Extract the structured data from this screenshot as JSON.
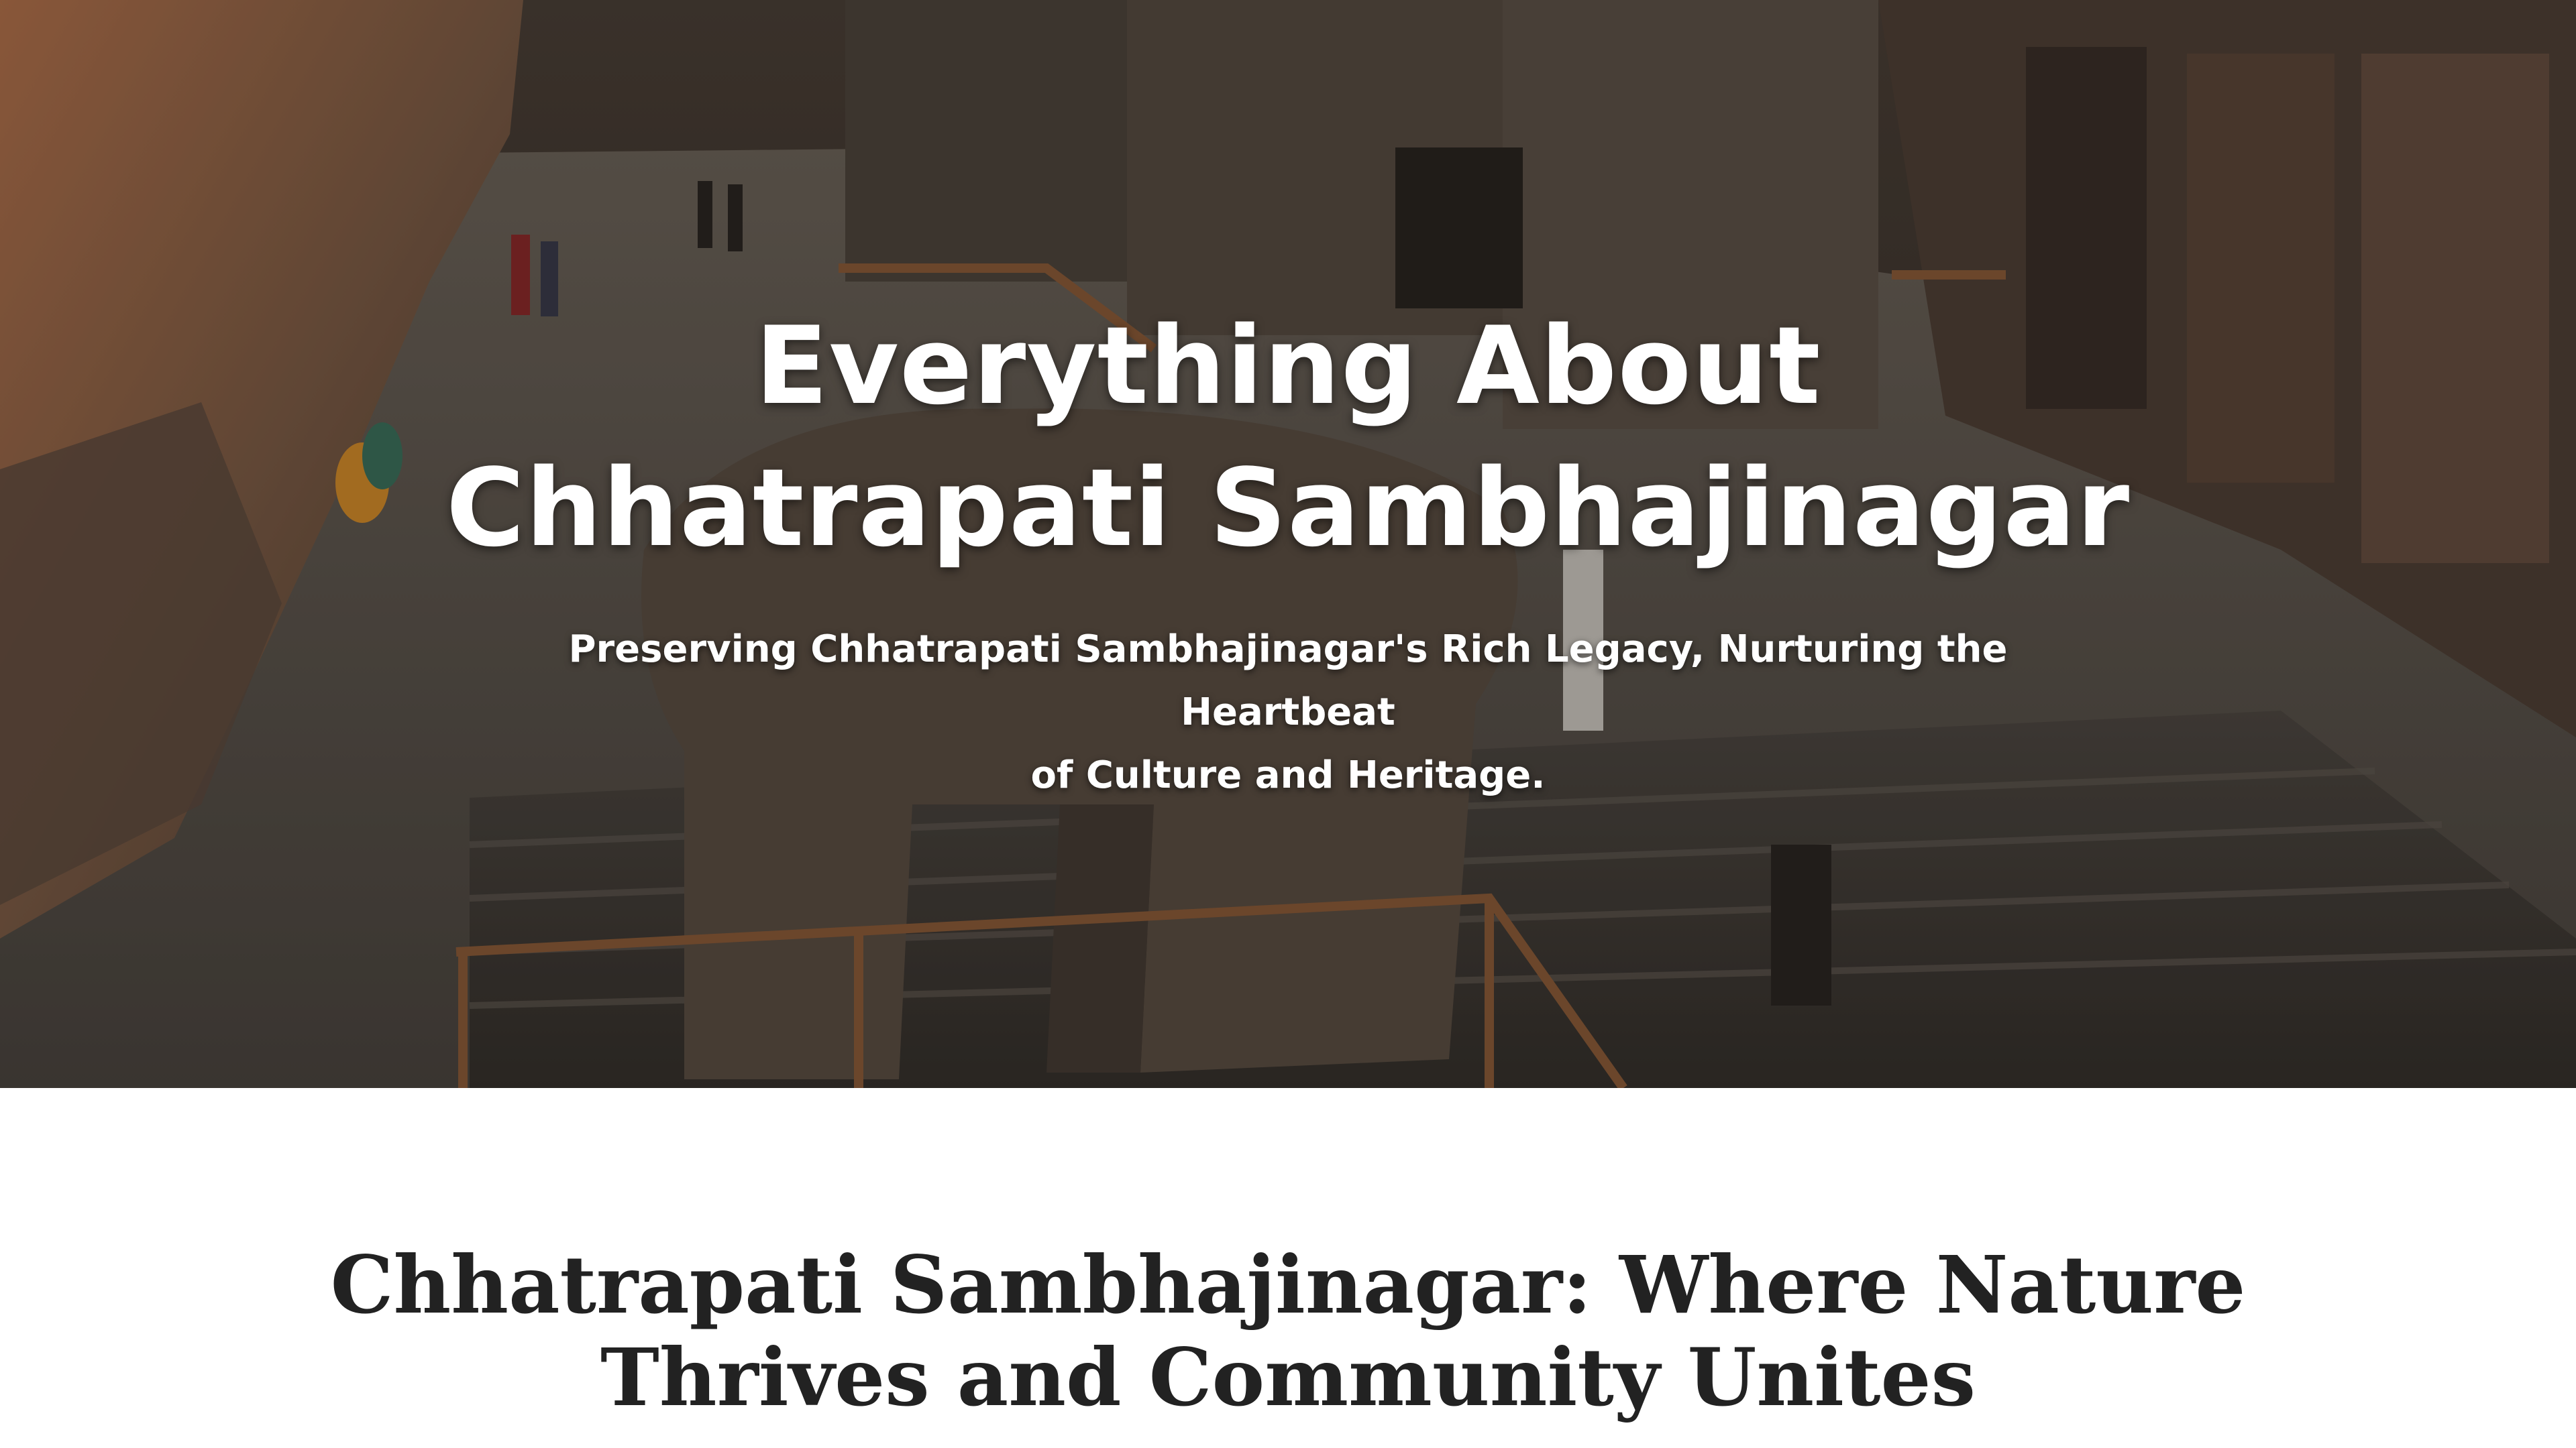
{
  "hero": {
    "title_line1": "Everything About",
    "title_line2": "Chhatrapati Sambhajinagar",
    "subtitle_line1": "Preserving Chhatrapati Sambhajinagar's Rich Legacy, Nurturing the Heartbeat",
    "subtitle_line2": "of Culture and Heritage."
  },
  "intro": {
    "heading_line1": "Chhatrapati Sambhajinagar: Where Nature",
    "heading_line2": "Thrives and Community Unites"
  },
  "colors": {
    "hero_text": "#ffffff",
    "heading_text": "#222222",
    "page_background": "#ffffff"
  }
}
